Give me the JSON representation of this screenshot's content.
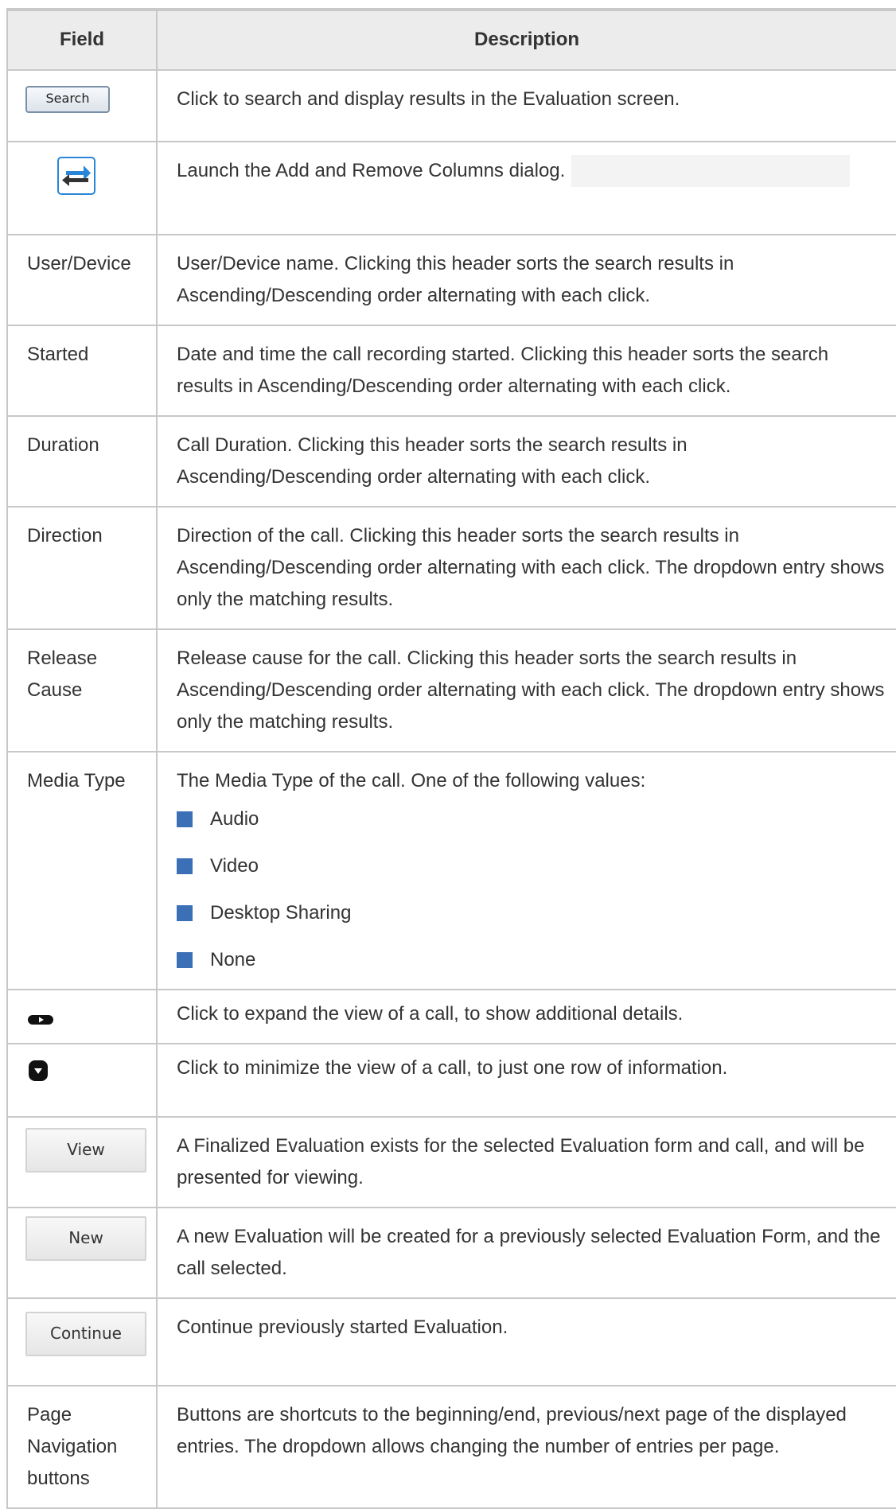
{
  "table": {
    "headers": {
      "field": "Field",
      "description": "Description"
    },
    "rows": {
      "search": {
        "button_label": "Search",
        "description": "Click to search and display results in the Evaluation screen."
      },
      "columns": {
        "icon": "swap-columns-icon",
        "description": "Launch the Add and Remove Columns dialog."
      },
      "user_device": {
        "field": "User/Device",
        "description": "User/Device name. Clicking this header sorts the search results in Ascending/Descending order alternating with each click."
      },
      "started": {
        "field": "Started",
        "description": "Date and time the call recording started. Clicking this header sorts the search results in Ascending/Descending order alternating with each click."
      },
      "duration": {
        "field": "Duration",
        "description": "Call Duration. Clicking this header sorts the search results in Ascending/Descending order alternating with each click."
      },
      "direction": {
        "field": "Direction",
        "description": "Direction of the call. Clicking this header sorts the search results in Ascending/Descending order alternating with each click. The dropdown entry shows only the matching results."
      },
      "release_cause": {
        "field": "Release Cause",
        "description": "Release cause for the call. Clicking this header sorts the search results in Ascending/Descending order alternating with each click. The dropdown entry shows only the matching results."
      },
      "media_type": {
        "field": "Media Type",
        "description": "The Media Type of the call. One of the following values:",
        "values": [
          "Audio",
          "Video",
          "Desktop Sharing",
          "None"
        ]
      },
      "expand": {
        "icon": "expand-icon",
        "description": "Click to expand the view of a call, to show additional details."
      },
      "collapse": {
        "icon": "collapse-icon",
        "description": "Click to minimize the view of a call, to just one row of information."
      },
      "view": {
        "button_label": "View",
        "description": "A Finalized Evaluation exists for the selected Evaluation form and call, and will be presented for viewing."
      },
      "new": {
        "button_label": "New",
        "description": "A new Evaluation will be created for a previously selected Evaluation Form, and the call selected."
      },
      "continue": {
        "button_label": "Continue",
        "description": "Continue previously started Evaluation."
      },
      "page_nav": {
        "field": "Page Navigation buttons",
        "description": "Buttons are shortcuts to the beginning/end, previous/next page of the displayed entries. The dropdown allows changing the number of entries per page."
      }
    }
  },
  "colors": {
    "border": "#c8c8c8",
    "header_bg": "#ececec",
    "bullet": "#3b6fb6",
    "icon_blue": "#2a86d6"
  }
}
